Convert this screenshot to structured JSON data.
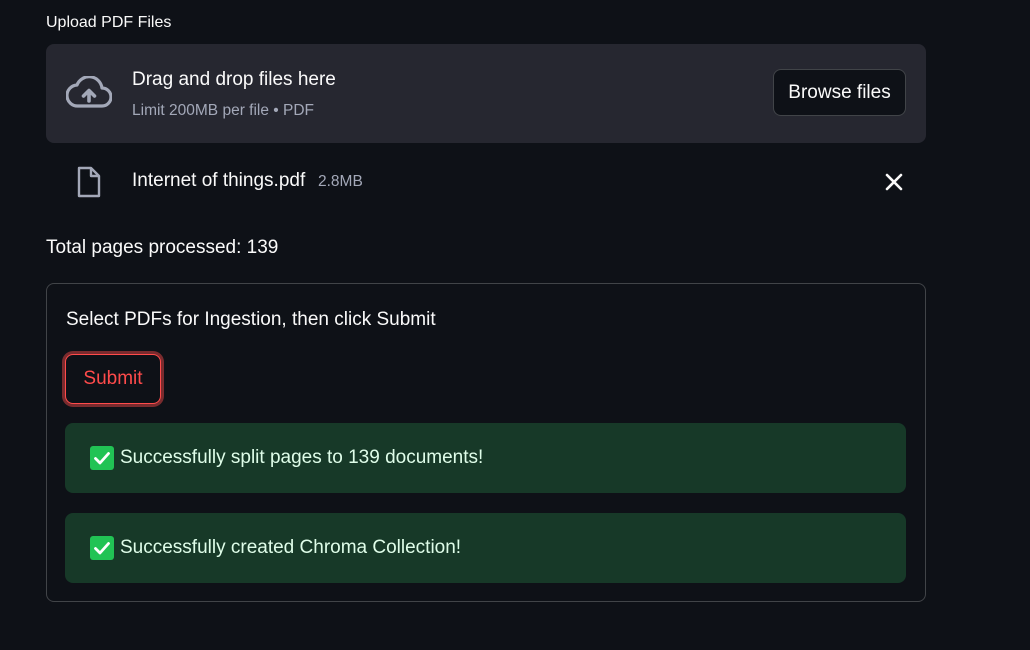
{
  "uploader": {
    "label": "Upload PDF Files",
    "dropzone_title": "Drag and drop files here",
    "dropzone_limit": "Limit 200MB per file • PDF",
    "browse_label": "Browse files",
    "upload_icon": "cloud-upload-icon"
  },
  "file": {
    "name": "Internet of things.pdf",
    "size": "2.8MB",
    "file_icon": "file-icon",
    "remove_icon": "close-icon"
  },
  "status": {
    "total_pages": "Total pages processed: 139"
  },
  "form": {
    "prompt": "Select PDFs for Ingestion, then click Submit",
    "submit_label": "Submit",
    "alerts": [
      {
        "text": "Successfully split pages to 139 documents!",
        "icon": "checkmark-icon"
      },
      {
        "text": "Successfully created Chroma Collection!",
        "icon": "checkmark-icon"
      }
    ]
  },
  "colors": {
    "background": "#0e1117",
    "dropzone": "#262730",
    "accent": "#ff4b4b",
    "success_bg": "#173928",
    "success_icon": "#21c354"
  }
}
